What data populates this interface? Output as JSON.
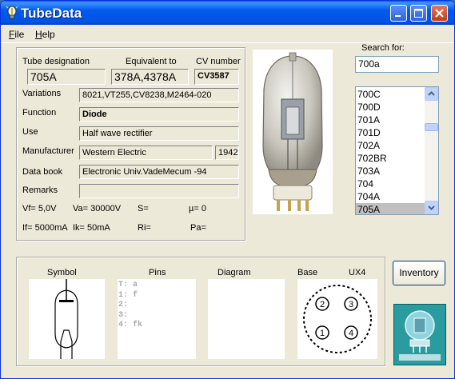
{
  "window": {
    "title": "TubeData"
  },
  "menu": {
    "file": "File",
    "help": "Help"
  },
  "labels": {
    "designation": "Tube designation",
    "equivalent": "Equivalent to",
    "cv": "CV number",
    "variations": "Variations",
    "function": "Function",
    "use": "Use",
    "manufacturer": "Manufacturer",
    "databook": "Data book",
    "remarks": "Remarks",
    "search": "Search for:",
    "symbol": "Symbol",
    "pins": "Pins",
    "diagram": "Diagram",
    "base": "Base"
  },
  "tube": {
    "designation": "705A",
    "equivalent": "378A,4378A",
    "cv": "CV3587",
    "variations": "8021,VT255,CV8238,M2464-020",
    "function": "Diode",
    "use": "Half wave rectifier",
    "manufacturer": "Western Electric",
    "year": "1942",
    "databook": "Electronic Univ.VadeMecum -94",
    "remarks": "",
    "vf": "Vf= 5,0V",
    "va": "Va= 30000V",
    "s": "S=",
    "mu": "µ=   0",
    "if": "If= 5000mA",
    "ik": "Ik=  50mA",
    "ri": "Ri=",
    "pa": "Pa=",
    "base_type": "UX4",
    "pins": [
      "T: a",
      "1: f",
      "2:",
      "3:",
      "4: fk"
    ],
    "base_pins": [
      "2",
      "3",
      "1",
      "4"
    ]
  },
  "search": {
    "value": "700a"
  },
  "list": {
    "items": [
      "700C",
      "700D",
      "701A",
      "701D",
      "702A",
      "702BR",
      "703A",
      "704",
      "704A",
      "705A"
    ],
    "selected": "705A"
  },
  "buttons": {
    "inventory": "Inventory"
  },
  "colors": {
    "titlebar": "#0054e3",
    "window_bg": "#ece9d8",
    "selection": "#c0c0c0",
    "close": "#c53a16"
  }
}
